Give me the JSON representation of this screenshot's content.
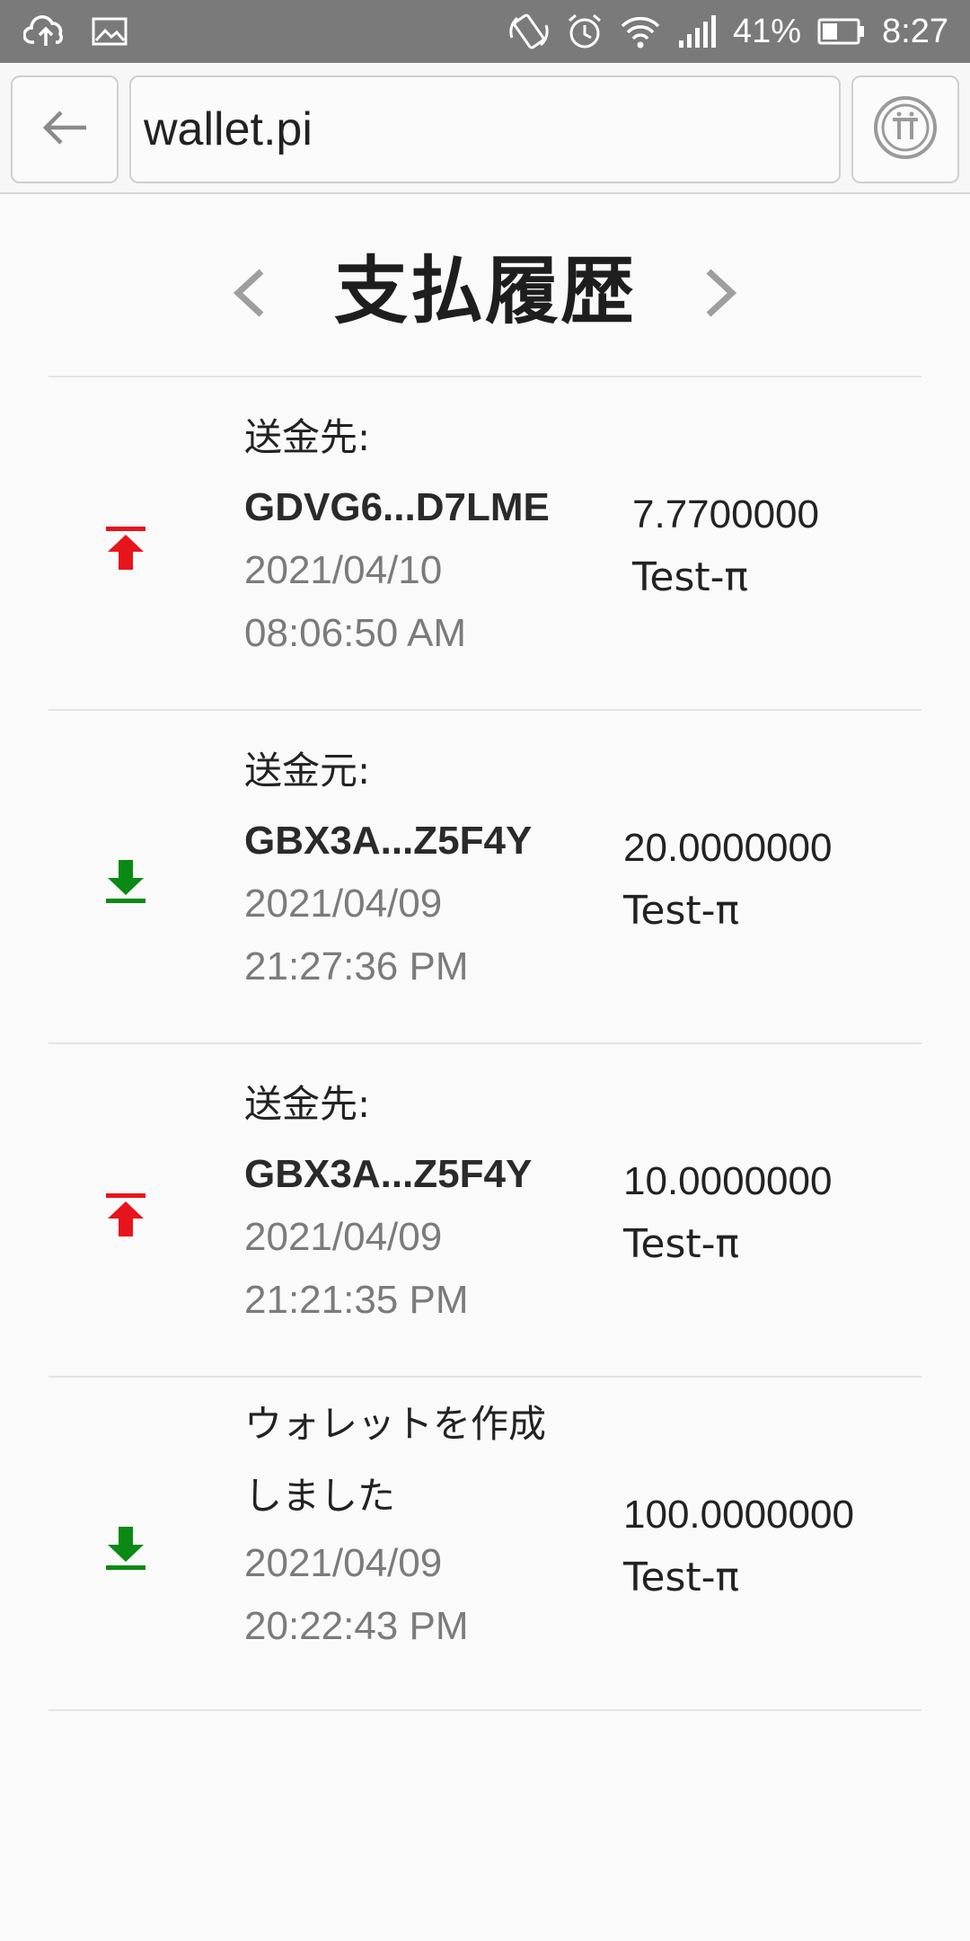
{
  "status_bar": {
    "battery_percent": "41%",
    "time": "8:27",
    "icons": [
      "cloud-upload-icon",
      "image-icon",
      "rotate-icon",
      "alarm-icon",
      "wifi-icon",
      "signal-icon",
      "battery-icon"
    ]
  },
  "browser": {
    "url": "wallet.pi",
    "back_icon": "back-arrow-icon",
    "app_icon": "pi-logo-icon"
  },
  "header": {
    "title": "支払履歴",
    "prev_icon": "chevron-left-icon",
    "next_icon": "chevron-right-icon"
  },
  "colors": {
    "outgoing": "#e8141b",
    "incoming": "#0a8a14"
  },
  "transactions": [
    {
      "direction": "outgoing",
      "icon": "send-up-arrow-icon",
      "label": "送金先:",
      "address": "GDVG6...D7LME",
      "date": "2021/04/10",
      "time": "08:06:50 AM",
      "amount": "7.7700000",
      "currency": "Test-π"
    },
    {
      "direction": "incoming",
      "icon": "receive-down-arrow-icon",
      "label": "送金元:",
      "address": "GBX3A...Z5F4Y",
      "date": "2021/04/09",
      "time": "21:27:36 PM",
      "amount": "20.0000000",
      "currency": "Test-π"
    },
    {
      "direction": "outgoing",
      "icon": "send-up-arrow-icon",
      "label": "送金先:",
      "address": "GBX3A...Z5F4Y",
      "date": "2021/04/09",
      "time": "21:21:35 PM",
      "amount": "10.0000000",
      "currency": "Test-π"
    },
    {
      "direction": "incoming",
      "icon": "receive-down-arrow-icon",
      "label": "ウォレットを作成しました",
      "address": "",
      "date": "2021/04/09",
      "time": "20:22:43 PM",
      "amount": "100.0000000",
      "currency": "Test-π"
    }
  ]
}
